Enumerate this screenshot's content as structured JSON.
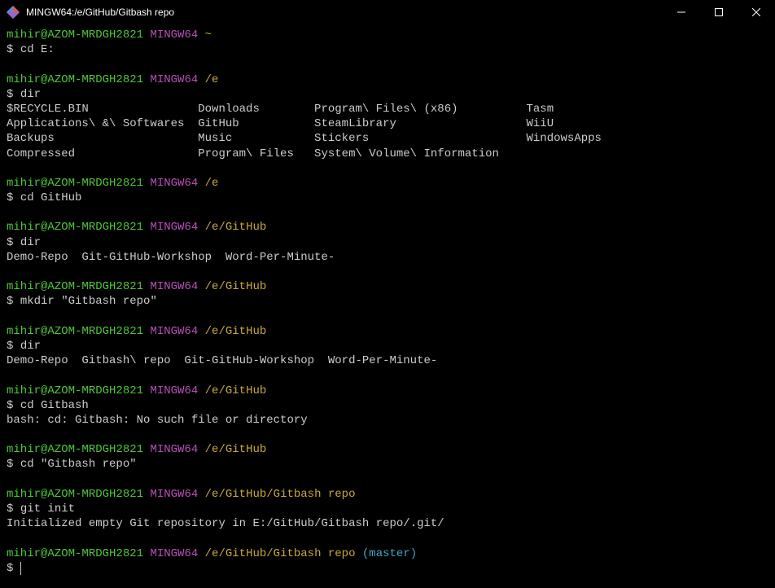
{
  "titlebar": {
    "title": "MINGW64:/e/GitHub/Gitbash repo"
  },
  "prompt": {
    "user": "mihir@AZOM-MRDGH2821",
    "shell": "MINGW64",
    "dollar": "$"
  },
  "sessions": [
    {
      "path": "~",
      "branch": "",
      "command": "cd E:",
      "output": []
    },
    {
      "path": "/e",
      "branch": "",
      "command": "dir",
      "output": [
        "$RECYCLE.BIN                Downloads        Program\\ Files\\ (x86)          Tasm",
        "Applications\\ &\\ Softwares  GitHub           SteamLibrary                   WiiU",
        "Backups                     Music            Stickers                       WindowsApps",
        "Compressed                  Program\\ Files   System\\ Volume\\ Information"
      ]
    },
    {
      "path": "/e",
      "branch": "",
      "command": "cd GitHub",
      "output": []
    },
    {
      "path": "/e/GitHub",
      "branch": "",
      "command": "dir",
      "output": [
        "Demo-Repo  Git-GitHub-Workshop  Word-Per-Minute-"
      ]
    },
    {
      "path": "/e/GitHub",
      "branch": "",
      "command": "mkdir \"Gitbash repo\"",
      "output": []
    },
    {
      "path": "/e/GitHub",
      "branch": "",
      "command": "dir",
      "output": [
        "Demo-Repo  Gitbash\\ repo  Git-GitHub-Workshop  Word-Per-Minute-"
      ]
    },
    {
      "path": "/e/GitHub",
      "branch": "",
      "command": "cd Gitbash",
      "output": [
        "bash: cd: Gitbash: No such file or directory"
      ]
    },
    {
      "path": "/e/GitHub",
      "branch": "",
      "command": "cd \"Gitbash repo\"",
      "output": []
    },
    {
      "path": "/e/GitHub/Gitbash repo",
      "branch": "",
      "command": "git init",
      "output": [
        "Initialized empty Git repository in E:/GitHub/Gitbash repo/.git/"
      ]
    },
    {
      "path": "/e/GitHub/Gitbash repo",
      "branch": "(master)",
      "command": "",
      "output": [],
      "cursor": true
    }
  ]
}
